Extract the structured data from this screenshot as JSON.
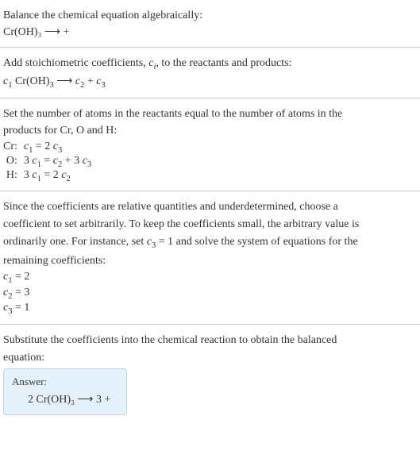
{
  "sec1": {
    "title": "Balance the chemical equation algebraically:",
    "eq": "Cr(OH)₃  ⟶  +"
  },
  "sec2": {
    "title_a": "Add stoichiometric coefficients, ",
    "title_ci": "c",
    "title_ci_sub": "i",
    "title_b": ", to the reactants and products:",
    "eq_c1": "c",
    "eq_c1sub": "1",
    "eq_species1": " Cr(OH)",
    "eq_species1_sub": "3",
    "eq_arrow": "  ⟶  ",
    "eq_c2": "c",
    "eq_c2sub": "2",
    "eq_plus": "  + ",
    "eq_c3": "c",
    "eq_c3sub": "3"
  },
  "sec3": {
    "intro1": "Set the number of atoms in the reactants equal to the number of atoms in the",
    "intro2": "products for Cr, O and H:",
    "rows": [
      {
        "label": "Cr:",
        "lhs_c": "c",
        "lhs_sub": "1",
        "eq": " = 2 ",
        "rhs_c": "c",
        "rhs_sub": "3",
        "extra": ""
      },
      {
        "label": "O:",
        "lhs_pre": "3 ",
        "lhs_c": "c",
        "lhs_sub": "1",
        "eq": " = ",
        "mid_c": "c",
        "mid_sub": "2",
        "plus": " + 3 ",
        "rhs_c": "c",
        "rhs_sub": "3"
      },
      {
        "label": "H:",
        "lhs_pre": "3 ",
        "lhs_c": "c",
        "lhs_sub": "1",
        "eq": " = 2 ",
        "rhs_c": "c",
        "rhs_sub": "2"
      }
    ]
  },
  "sec4": {
    "p1": "Since the coefficients are relative quantities and underdetermined, choose a",
    "p2": "coefficient to set arbitrarily. To keep the coefficients small, the arbitrary value is",
    "p3a": "ordinarily one. For instance, set ",
    "p3_c": "c",
    "p3_csub": "3",
    "p3b": " = 1 and solve the system of equations for the",
    "p4": "remaining coefficients:",
    "sols": [
      {
        "c": "c",
        "sub": "1",
        "val": " = 2"
      },
      {
        "c": "c",
        "sub": "2",
        "val": " = 3"
      },
      {
        "c": "c",
        "sub": "3",
        "val": " = 1"
      }
    ]
  },
  "sec5": {
    "p1": "Substitute the coefficients into the chemical reaction to obtain the balanced",
    "p2": "equation:",
    "answer_label": "Answer:",
    "answer_eq": "2 Cr(OH)₃  ⟶  3  +"
  }
}
